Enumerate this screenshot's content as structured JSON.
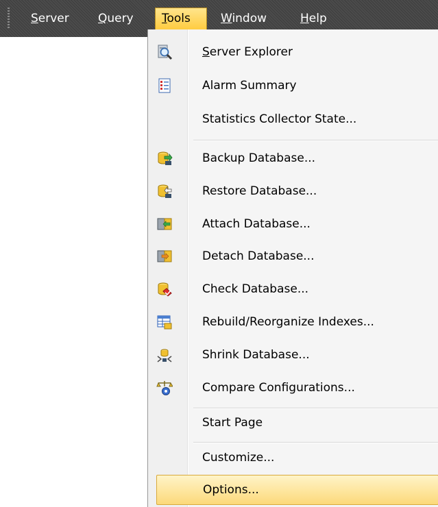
{
  "menubar": {
    "items": [
      {
        "key": "server",
        "accel": "S",
        "rest": "erver"
      },
      {
        "key": "query",
        "accel": "Q",
        "rest": "uery"
      },
      {
        "key": "tools",
        "accel": "T",
        "rest": "ools"
      },
      {
        "key": "window",
        "accel": "W",
        "rest": "indow"
      },
      {
        "key": "help",
        "accel": "H",
        "rest": "elp"
      }
    ],
    "open_menu": "Tools"
  },
  "tools_menu": {
    "items": [
      {
        "label_accel": "S",
        "label_rest": "erver Explorer",
        "icon": "magnifier-server-icon"
      },
      {
        "label": "Alarm Summary",
        "icon": "alarm-list-icon"
      },
      {
        "label": "Statistics Collector State...",
        "icon": ""
      },
      {
        "label": "Backup Database...",
        "icon": "backup-database-icon"
      },
      {
        "label": "Restore Database...",
        "icon": "restore-database-icon"
      },
      {
        "label": "Attach Database...",
        "icon": "attach-database-icon"
      },
      {
        "label": "Detach Database...",
        "icon": "detach-database-icon"
      },
      {
        "label": "Check Database...",
        "icon": "check-database-icon"
      },
      {
        "label": "Rebuild/Reorganize Indexes...",
        "icon": "rebuild-indexes-icon"
      },
      {
        "label": "Shrink Database...",
        "icon": "shrink-database-icon"
      },
      {
        "label": "Compare Configurations...",
        "icon": "compare-configurations-icon"
      },
      {
        "label": "Start Page",
        "icon": ""
      },
      {
        "label": "Customize...",
        "icon": ""
      },
      {
        "label": "Options...",
        "icon": "",
        "highlighted": true
      }
    ]
  }
}
